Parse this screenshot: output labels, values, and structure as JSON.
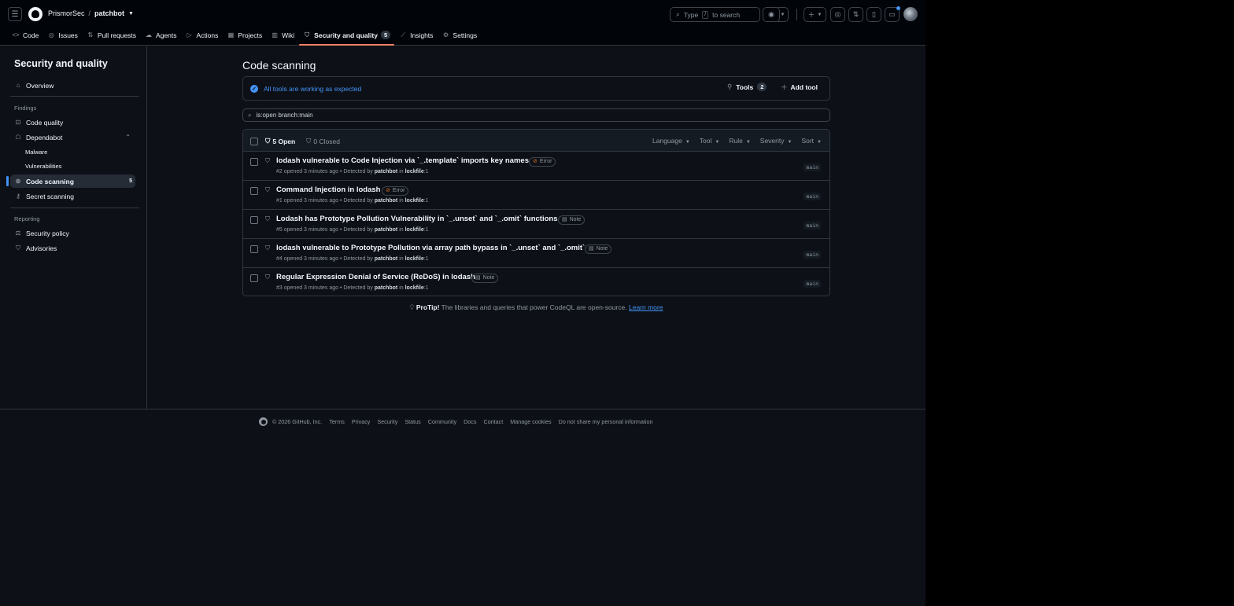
{
  "header": {
    "owner": "PrismorSec",
    "separator": "/",
    "repo": "patchbot",
    "search_prefix": "Type",
    "search_key": "/",
    "search_suffix": "to search"
  },
  "tabs": [
    {
      "label": "Code",
      "icon": "code-icon"
    },
    {
      "label": "Issues",
      "icon": "issue-opened-icon"
    },
    {
      "label": "Pull requests",
      "icon": "git-pull-request-icon"
    },
    {
      "label": "Agents",
      "icon": "agent-icon"
    },
    {
      "label": "Actions",
      "icon": "play-icon"
    },
    {
      "label": "Projects",
      "icon": "table-icon"
    },
    {
      "label": "Wiki",
      "icon": "book-icon"
    },
    {
      "label": "Security and quality",
      "icon": "shield-icon",
      "count": "5"
    },
    {
      "label": "Insights",
      "icon": "graph-icon"
    },
    {
      "label": "Settings",
      "icon": "gear-icon"
    }
  ],
  "sidebar": {
    "title": "Security and quality",
    "overview": "Overview",
    "findings_heading": "Findings",
    "code_quality": "Code quality",
    "dependabot": "Dependabot",
    "malware": "Malware",
    "vulnerabilities": "Vulnerabilities",
    "code_scanning": "Code scanning",
    "code_scanning_count": "5",
    "secret_scanning": "Secret scanning",
    "reporting_heading": "Reporting",
    "security_policy": "Security policy",
    "advisories": "Advisories"
  },
  "main": {
    "title": "Code scanning",
    "status": "All tools are working as expected",
    "tools_label": "Tools",
    "tools_count": "2",
    "add_tool": "Add tool",
    "filter_value": "is:open branch:main",
    "open_label": "5 Open",
    "closed_label": "0 Closed",
    "filters": [
      "Language",
      "Tool",
      "Rule",
      "Severity",
      "Sort"
    ],
    "alerts": [
      {
        "title": "lodash vulnerable to Code Injection via `_.template` imports key names",
        "severity": "Error",
        "number": "#2",
        "opened": "opened 3 minutes ago",
        "detected": "Detected by",
        "tool": "patchbot",
        "in": "in",
        "file": "lockfile",
        "line": ":1",
        "branch": "main"
      },
      {
        "title": "Command Injection in lodash",
        "severity": "Error",
        "number": "#1",
        "opened": "opened 3 minutes ago",
        "detected": "Detected by",
        "tool": "patchbot",
        "in": "in",
        "file": "lockfile",
        "line": ":1",
        "branch": "main"
      },
      {
        "title": "Lodash has Prototype Pollution Vulnerability in `_.unset` and `_.omit` functions",
        "severity": "Note",
        "number": "#5",
        "opened": "opened 3 minutes ago",
        "detected": "Detected by",
        "tool": "patchbot",
        "in": "in",
        "file": "lockfile",
        "line": ":1",
        "branch": "main"
      },
      {
        "title": "lodash vulnerable to Prototype Pollution via array path bypass in `_.unset` and `_.omit`",
        "severity": "Note",
        "number": "#4",
        "opened": "opened 3 minutes ago",
        "detected": "Detected by",
        "tool": "patchbot",
        "in": "in",
        "file": "lockfile",
        "line": ":1",
        "branch": "main"
      },
      {
        "title": "Regular Expression Denial of Service (ReDoS) in lodash",
        "severity": "Note",
        "number": "#3",
        "opened": "opened 3 minutes ago",
        "detected": "Detected by",
        "tool": "patchbot",
        "in": "in",
        "file": "lockfile",
        "line": ":1",
        "branch": "main"
      }
    ],
    "protip_bold": "ProTip!",
    "protip_text": "The libraries and queries that power CodeQL are open-source.",
    "protip_link": "Learn more"
  },
  "footer": {
    "copyright": "© 2026 GitHub, Inc.",
    "links": [
      "Terms",
      "Privacy",
      "Security",
      "Status",
      "Community",
      "Docs",
      "Contact",
      "Manage cookies",
      "Do not share my personal information"
    ]
  },
  "colors": {
    "accent": "#4493f8",
    "active_tab_underline": "#f78166",
    "error": "#db6d28",
    "background": "#0d1117"
  }
}
